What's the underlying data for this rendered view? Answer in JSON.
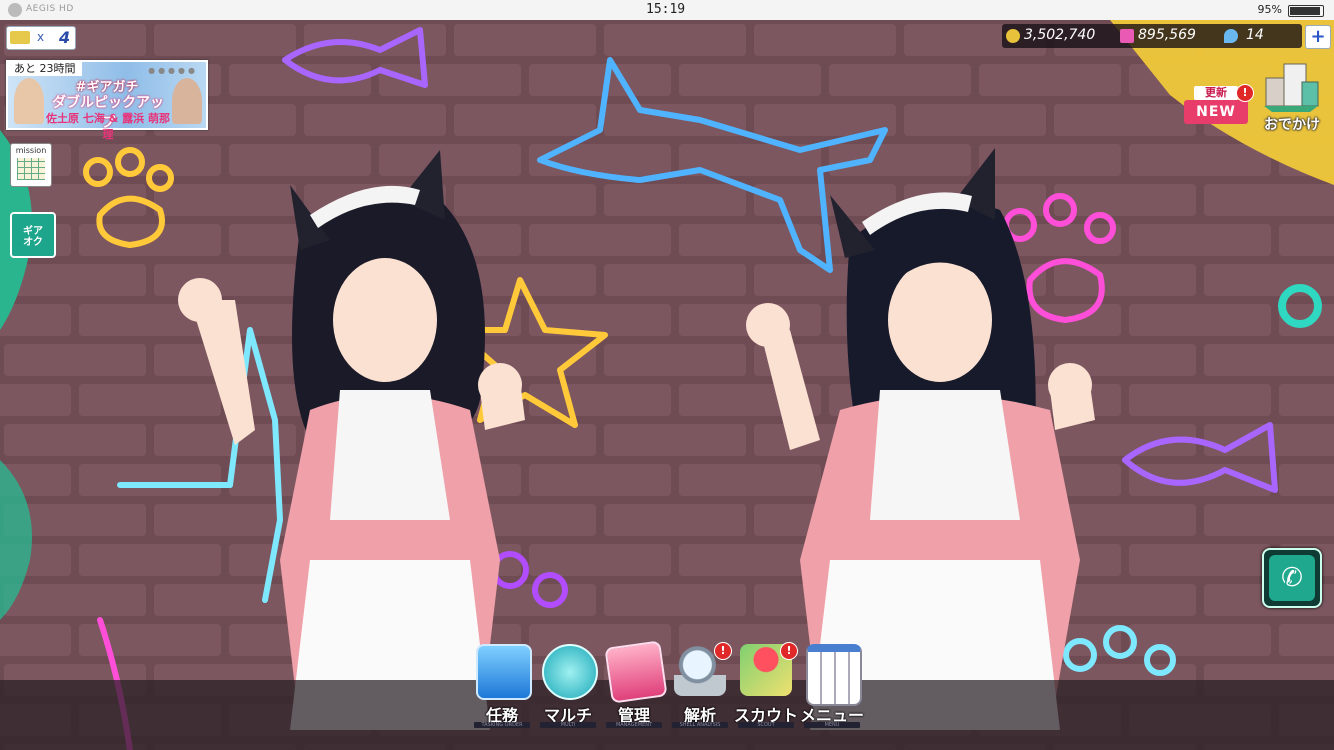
{
  "status_bar": {
    "brand": "AEGIS HD",
    "time": "15:19",
    "battery_percent": "95%",
    "battery_level": 0.95
  },
  "ticket": {
    "multiplier": "x",
    "count": "4"
  },
  "banner": {
    "remaining": "あと 23時間",
    "title_line1": "#ギアガチ",
    "title_line2": "ダブルピックアップ",
    "title_line3": "佐土原 七海 & 露浜 萌那理"
  },
  "side_buttons": {
    "mission_label": "mission",
    "gear_shop_label": "ギア\nオク"
  },
  "currency": {
    "gold": "3,502,740",
    "pink": "895,569",
    "gems": "14",
    "plus": "+"
  },
  "update": {
    "top": "更新",
    "bottom": "NEW",
    "badge": "!"
  },
  "odekake": {
    "label": "おでかけ"
  },
  "phone": {
    "icon": "phone-icon"
  },
  "menu": [
    {
      "label": "任務",
      "sub": "TASKING ORDER",
      "icon": "mission-shield-icon",
      "badge": ""
    },
    {
      "label": "マルチ",
      "sub": "MULTI",
      "icon": "multi-people-icon",
      "badge": ""
    },
    {
      "label": "管理",
      "sub": "MANAGEMENT",
      "icon": "management-card-icon",
      "badge": ""
    },
    {
      "label": "解析",
      "sub": "SHELL ANALYSIS",
      "icon": "analysis-magnifier-icon",
      "badge": "!"
    },
    {
      "label": "スカウト",
      "sub": "SCOUT",
      "icon": "scout-map-icon",
      "badge": "!"
    },
    {
      "label": "メニュー",
      "sub": "MENU",
      "icon": "menu-folder-icon",
      "badge": ""
    }
  ],
  "colors": {
    "wall": "#6e4a52",
    "neon_blue": "#4fb3ff",
    "neon_purple": "#a866ff",
    "neon_yellow": "#ffc93a",
    "neon_pink": "#ff4fd8",
    "neon_cyan": "#7ee8ff",
    "accent_teal": "#1fa88e"
  }
}
